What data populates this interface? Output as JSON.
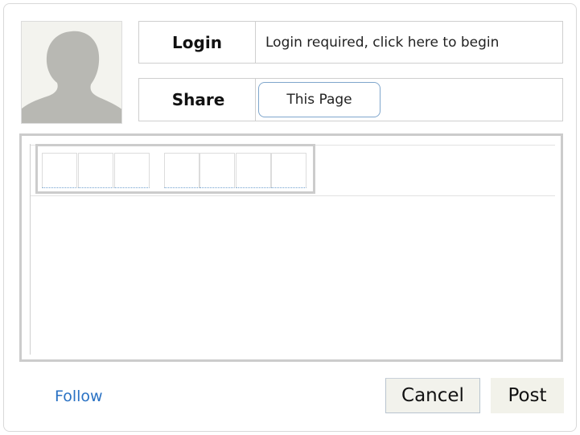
{
  "header": {
    "login_label": "Login",
    "login_value": "Login required, click here to begin",
    "share_label": "Share",
    "share_button": "This Page"
  },
  "editor": {
    "toolbar_buttons": [
      "",
      "",
      "",
      "",
      "",
      "",
      ""
    ],
    "content": ""
  },
  "footer": {
    "follow_link": "Follow",
    "cancel_button": "Cancel",
    "post_button": "Post"
  },
  "colors": {
    "link": "#2a72c4",
    "border": "#cccccc",
    "button_bg": "#f2f2ec",
    "avatar_bg": "#f3f3ee",
    "avatar_silhouette": "#b8b8b3"
  }
}
